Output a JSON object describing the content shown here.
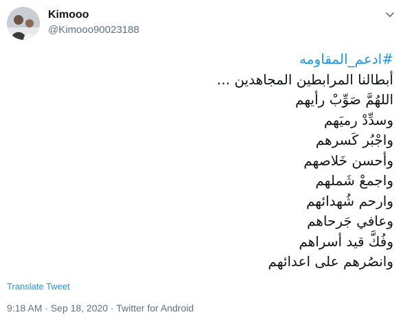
{
  "user": {
    "display_name": "Kimooo",
    "handle": "@Kimooo90023188"
  },
  "tweet": {
    "hashtag": "#ادعم_المقاومه",
    "lines": [
      "أبطالنا المرابطين المجاهدين ...",
      "اللهُمَّ صَوِّبْ رأيهم",
      "وسدِّدْ رميَهم",
      "واجْبُر كَسرهم",
      "وأحسن خَلاصهم",
      "واجمعْ شَملهم",
      "وارحم شُهدائهم",
      "وعافي جَرحاهم",
      "وفُكَّ قيد أسراهم",
      "وانصُرهم على اعدائهم"
    ],
    "translate_label": "Translate Tweet"
  },
  "meta": {
    "time": "9:18 AM",
    "separator": "·",
    "date": "Sep 18, 2020",
    "source": "Twitter for Android"
  },
  "icons": {
    "avatar": "user-avatar-photo",
    "caret": "chevron-down-icon"
  },
  "colors": {
    "link": "#1b95e0",
    "secondary_text": "#5b7083",
    "primary_text": "#0f1419"
  }
}
